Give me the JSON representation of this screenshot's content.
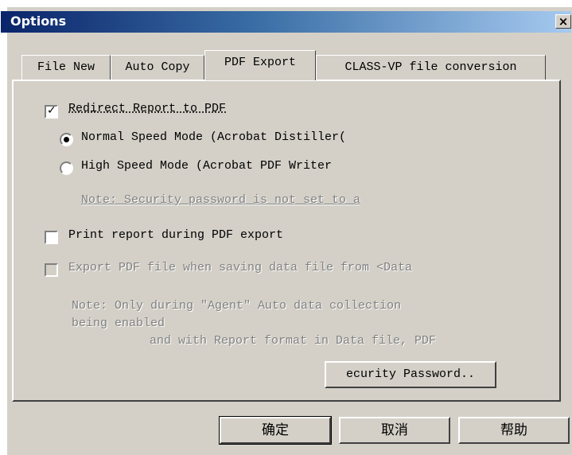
{
  "window": {
    "title": "Options"
  },
  "tabs": [
    {
      "label": "File New"
    },
    {
      "label": "Auto Copy"
    },
    {
      "label": "PDF Export"
    },
    {
      "label": "CLASS-VP file conversion"
    }
  ],
  "pdf_export": {
    "redirect_label": "Redirect Report to PDF",
    "redirect_checked": true,
    "normal_label": "Normal Speed Mode (Acrobat Distiller(",
    "high_label": "High Speed Mode (Acrobat PDF Writer",
    "selected_mode": "normal",
    "note_security": "Note: Security password is not set to a",
    "print_label": "Print report during PDF export",
    "print_checked": false,
    "export_label": "Export PDF file when saving data file from <Data",
    "export_checked": false,
    "note_agent_1": "Note: Only during \"Agent\" Auto data collection",
    "note_agent_2": "being enabled",
    "note_agent_3": "and with Report format in Data file, PDF",
    "security_button": "ecurity Password.."
  },
  "footer": {
    "ok": "确定",
    "cancel": "取消",
    "help": "帮助"
  }
}
